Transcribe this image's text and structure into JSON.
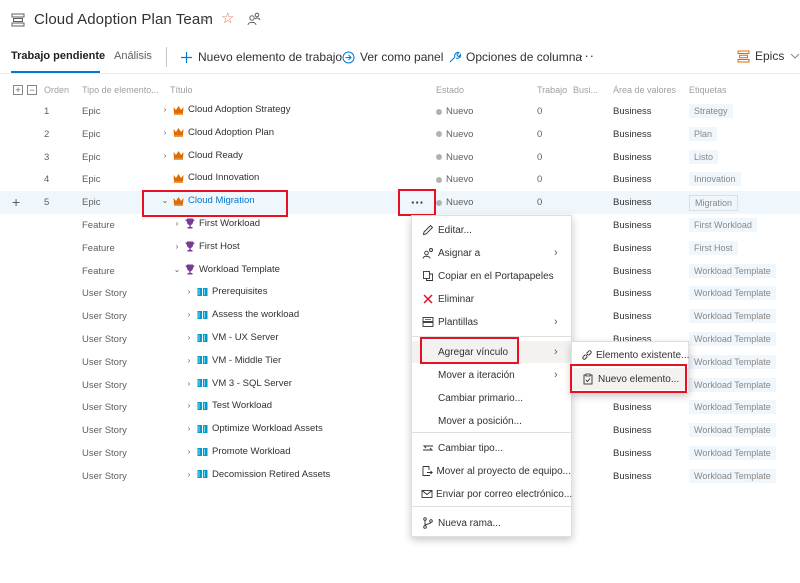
{
  "header": {
    "team_title": "Cloud Adoption Plan Team",
    "icons": [
      "backlog-board-icon",
      "chevron-down-icon",
      "star-icon",
      "team-members-icon"
    ]
  },
  "toolbar": {
    "tabs": [
      {
        "label": "Trabajo pendiente",
        "active": true
      },
      {
        "label": "Análisis",
        "active": false
      }
    ],
    "new_item_label": "Nuevo elemento de trabajo",
    "view_board_label": "Ver como panel",
    "column_options_label": "Opciones de columna",
    "more_label": "···",
    "backlog_level_label": "Epics"
  },
  "colors": {
    "accent": "#0078d4",
    "epic": "#e06c00",
    "feature": "#773b93",
    "user_story": "#009ccc",
    "highlight_box": "#e81123",
    "state_new": "#b2b2b2"
  },
  "grid": {
    "columns": {
      "order": "Orden",
      "type": "Tipo de elemento...",
      "title": "Título",
      "state": "Estado",
      "work": "Trabajo",
      "business": "Busi...",
      "value_area": "Área de valores",
      "tags": "Etiquetas"
    },
    "rows": [
      {
        "order": "1",
        "type": "Epic",
        "title": "Cloud Adoption Strategy",
        "state": "Nuevo",
        "work": "0",
        "area": "Business",
        "tag": "Strategy",
        "toggle": "›",
        "icon": "epic"
      },
      {
        "order": "2",
        "type": "Epic",
        "title": "Cloud Adoption Plan",
        "state": "Nuevo",
        "work": "0",
        "area": "Business",
        "tag": "Plan",
        "toggle": "›",
        "icon": "epic"
      },
      {
        "order": "3",
        "type": "Epic",
        "title": "Cloud Ready",
        "state": "Nuevo",
        "work": "0",
        "area": "Business",
        "tag": "Listo",
        "toggle": "›",
        "icon": "epic"
      },
      {
        "order": "4",
        "type": "Epic",
        "title": "Cloud Innovation",
        "state": "Nuevo",
        "work": "0",
        "area": "Business",
        "tag": "Innovation",
        "toggle": "",
        "icon": "epic"
      },
      {
        "order": "5",
        "type": "Epic",
        "title": "Cloud Migration",
        "state": "Nuevo",
        "work": "0",
        "area": "Business",
        "tag": "Migration",
        "toggle": "⌄",
        "icon": "epic",
        "selected": true
      },
      {
        "order": "",
        "type": "Feature",
        "title": "First Workload",
        "state": "",
        "work": "",
        "area": "Business",
        "tag": "First Workload",
        "toggle": "›",
        "icon": "feature"
      },
      {
        "order": "",
        "type": "Feature",
        "title": "First Host",
        "state": "",
        "work": "",
        "area": "Business",
        "tag": "First Host",
        "toggle": "›",
        "icon": "feature"
      },
      {
        "order": "",
        "type": "Feature",
        "title": "Workload Template",
        "state": "",
        "work": "",
        "area": "Business",
        "tag": "Workload Template",
        "toggle": "⌄",
        "icon": "feature"
      },
      {
        "order": "",
        "type": "User Story",
        "title": "Prerequisites",
        "state": "",
        "work": "",
        "area": "Business",
        "tag": "Workload Template",
        "toggle": "›",
        "icon": "story"
      },
      {
        "order": "",
        "type": "User Story",
        "title": "Assess the workload",
        "state": "",
        "work": "",
        "area": "Business",
        "tag": "Workload Template",
        "toggle": "›",
        "icon": "story"
      },
      {
        "order": "",
        "type": "User Story",
        "title": "VM - UX Server",
        "state": "",
        "work": "",
        "area": "Business",
        "tag": "Workload Template",
        "toggle": "›",
        "icon": "story"
      },
      {
        "order": "",
        "type": "User Story",
        "title": "VM - Middle Tier",
        "state": "",
        "work": "",
        "area": "",
        "tag": "Workload Template",
        "toggle": "›",
        "icon": "story"
      },
      {
        "order": "",
        "type": "User Story",
        "title": "VM 3 - SQL Server",
        "state": "",
        "work": "",
        "area": "",
        "tag": "Workload Template",
        "toggle": "›",
        "icon": "story"
      },
      {
        "order": "",
        "type": "User Story",
        "title": "Test Workload",
        "state": "",
        "work": "",
        "area": "Business",
        "tag": "Workload Template",
        "toggle": "›",
        "icon": "story"
      },
      {
        "order": "",
        "type": "User Story",
        "title": "Optimize Workload Assets",
        "state": "",
        "work": "",
        "area": "Business",
        "tag": "Workload Template",
        "toggle": "›",
        "icon": "story"
      },
      {
        "order": "",
        "type": "User Story",
        "title": "Promote Workload",
        "state": "",
        "work": "",
        "area": "Business",
        "tag": "Workload Template",
        "toggle": "›",
        "icon": "story"
      },
      {
        "order": "",
        "type": "User Story",
        "title": "Decomission Retired Assets",
        "state": "",
        "work": "",
        "area": "Business",
        "tag": "Workload Template",
        "toggle": "›",
        "icon": "story"
      }
    ]
  },
  "context_menu": {
    "items": [
      {
        "label": "Editar...",
        "icon": "pencil-icon",
        "submenu": false
      },
      {
        "label": "Asignar a",
        "icon": "assign-user-icon",
        "submenu": true
      },
      {
        "label": "Copiar en el Portapapeles",
        "icon": "copy-icon",
        "submenu": false
      },
      {
        "label": "Eliminar",
        "icon": "delete-x-icon",
        "submenu": false
      },
      {
        "label": "Plantillas",
        "icon": "templates-icon",
        "submenu": true
      },
      {
        "label": "Agregar vínculo",
        "icon": "",
        "submenu": true,
        "highlighted": true
      },
      {
        "label": "Mover a iteración",
        "icon": "",
        "submenu": true
      },
      {
        "label": "Cambiar primario...",
        "icon": "",
        "submenu": false
      },
      {
        "label": "Mover a posición...",
        "icon": "",
        "submenu": false
      },
      {
        "label": "Cambiar tipo...",
        "icon": "change-type-icon",
        "submenu": false
      },
      {
        "label": "Mover al proyecto de equipo...",
        "icon": "move-project-icon",
        "submenu": false
      },
      {
        "label": "Enviar por correo electrónico...",
        "icon": "mail-icon",
        "submenu": false
      },
      {
        "label": "Nueva rama...",
        "icon": "branch-icon",
        "submenu": false
      }
    ]
  },
  "link_submenu": {
    "items": [
      {
        "label": "Elemento existente...",
        "icon": "link-icon"
      },
      {
        "label": "Nuevo elemento...",
        "icon": "new-item-clipboard-icon",
        "highlighted": true
      }
    ]
  }
}
